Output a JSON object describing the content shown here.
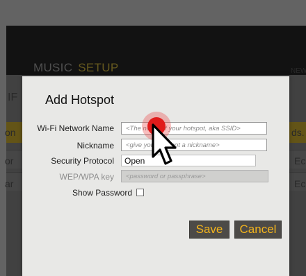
{
  "background": {
    "nav": [
      "MUSIC",
      "SETUP"
    ],
    "fragments": {
      "left_header": "IF",
      "left_row1": "on",
      "left_row2": "or",
      "left_row3": "ar",
      "right_top": "NEW",
      "right_row1": "ds.",
      "right_row2": "Ec",
      "right_row3": "Ec"
    }
  },
  "dialog": {
    "title": "Add Hotspot",
    "fields": {
      "ssid": {
        "label": "Wi-Fi Network Name",
        "placeholder": "<The name of your hotspot, aka SSID>"
      },
      "nickname": {
        "label": "Nickname",
        "placeholder": "<give your hotspot a nickname>"
      },
      "security": {
        "label": "Security Protocol",
        "value": "Open"
      },
      "wep_key": {
        "label": "WEP/WPA key",
        "placeholder": "<password or passphrase>"
      },
      "show_password": {
        "label": "Show Password",
        "checked": false
      }
    },
    "buttons": {
      "save": "Save",
      "cancel": "Cancel"
    }
  },
  "colors": {
    "accent": "#f3b41c",
    "button_bg": "#4c4a47",
    "click_marker": "#e11b1b"
  }
}
